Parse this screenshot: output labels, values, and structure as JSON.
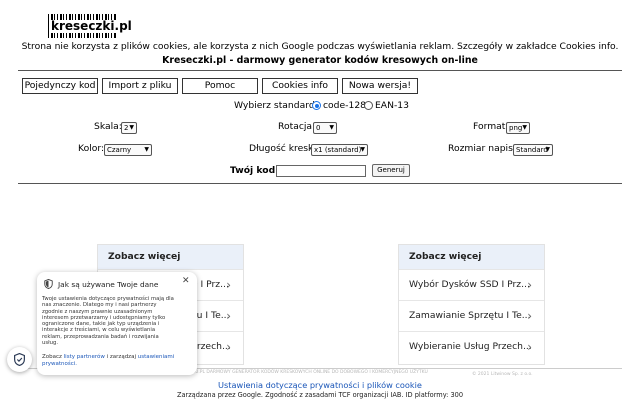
{
  "header": {
    "logo_text": "kreseczki.pl",
    "cookie_notice": "Strona nie korzysta z plików cookies, ale korzysta z nich Google podczas wyświetlania reklam. Szczegóły w zakładce Cookies info.",
    "tagline": "Kreseczki.pl - darmowy generator kodów kresowych on-line"
  },
  "nav": {
    "items": [
      {
        "label": "Pojedynczy kod"
      },
      {
        "label": "Import z pliku"
      },
      {
        "label": "Pomoc"
      },
      {
        "label": "Cookies info"
      },
      {
        "label": "Nowa wersja!"
      }
    ]
  },
  "form": {
    "standard_label": "Wybierz standard:",
    "standard_options": [
      "code-128",
      "EAN-13"
    ],
    "standard_selected": "code-128",
    "scale_label": "Skala:",
    "scale_value": "2",
    "rotation_label": "Rotacja:",
    "rotation_value": "0",
    "format_label": "Format:",
    "format_value": "png",
    "color_label": "Kolor:",
    "color_value": "Czarny",
    "bar_length_label": "Długość kreski:",
    "bar_length_value": "x1 (standard)",
    "font_size_label": "Rozmiar napisu:",
    "font_size_value": "Standard",
    "code_label": "Twój kod:",
    "code_value": "",
    "generate_label": "Generuj"
  },
  "ads": {
    "left": {
      "heading": "Zobacz więcej",
      "items": [
        "Wybór Dysków SSD I Prz...",
        "Zamawianie Sprzętu I Te...",
        "Wybieranie Usług Przech..."
      ]
    },
    "right": {
      "heading": "Zobacz więcej",
      "items": [
        "Wybór Dysków SSD I Prz...",
        "Zamawianie Sprzętu I Te...",
        "Wybieranie Usług Przech..."
      ]
    }
  },
  "footer": {
    "faint_left": "ECZKI.PL DARMOWY GENERATOR KODÓW KRESKOWYCH ONLINE DO DOBOWEGO I KOMERCYJNEGO UŻYTKU",
    "faint_right": "© 2021 Litwinow Sp. z o.o.",
    "privacy_link": "Ustawienia dotyczące prywatności i plików cookie",
    "managed_by": "Zarządzana przez Google. Zgodność z zasadami TCF organizacji IAB. ID platformy: 300"
  },
  "consent_popup": {
    "title": "Jak są używane Twoje dane",
    "body": "Twoje ustawienia dotyczące prywatności mają dla nas znaczenie. Dlatego my i nasi partnerzy zgodnie z naszym prawnie uzasadnionym interesem przetwarzamy i udostępniamy tylko ograniczone dane, takie jak typ urządzenia i interakcje z treściami, w celu wyświetlania reklam, przeprowadzania badań i rozwijania usług.",
    "foot_prefix": "Zobacz",
    "foot_link1": "listy partnerów",
    "foot_middle": "i zarządzaj",
    "foot_link2": "ustawieniami prywatności."
  },
  "colors": {
    "accent_blue": "#1a73e8",
    "link_blue": "#1a56b8",
    "card_header": "#eaf0f9"
  }
}
